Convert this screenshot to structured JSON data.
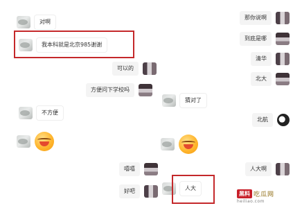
{
  "messages": [
    {
      "id": "m1",
      "text": "对啊"
    },
    {
      "id": "m2",
      "text": "我本科就是北京985谢谢"
    },
    {
      "id": "m3",
      "text": "那你说啊"
    },
    {
      "id": "m4",
      "text": "到底是哪"
    },
    {
      "id": "m5",
      "text": "清华"
    },
    {
      "id": "m6",
      "text": "北大"
    },
    {
      "id": "m7",
      "text": "可以的"
    },
    {
      "id": "m8",
      "text": "方便问下学校吗"
    },
    {
      "id": "m9",
      "text": "猜对了"
    },
    {
      "id": "m10",
      "text": "不方便"
    },
    {
      "id": "m11",
      "text": "北航"
    },
    {
      "id": "m12",
      "text": "人大啊"
    },
    {
      "id": "m13",
      "text": "嘻嘻"
    },
    {
      "id": "m14",
      "text": "好吧"
    },
    {
      "id": "m15",
      "text": "人大"
    }
  ],
  "watermark": {
    "logo": "黑料",
    "name": "吃瓜网",
    "url": "heiliao.com"
  },
  "colors": {
    "highlight_border": "#c4282a",
    "bubble": "#f4f4f4"
  }
}
